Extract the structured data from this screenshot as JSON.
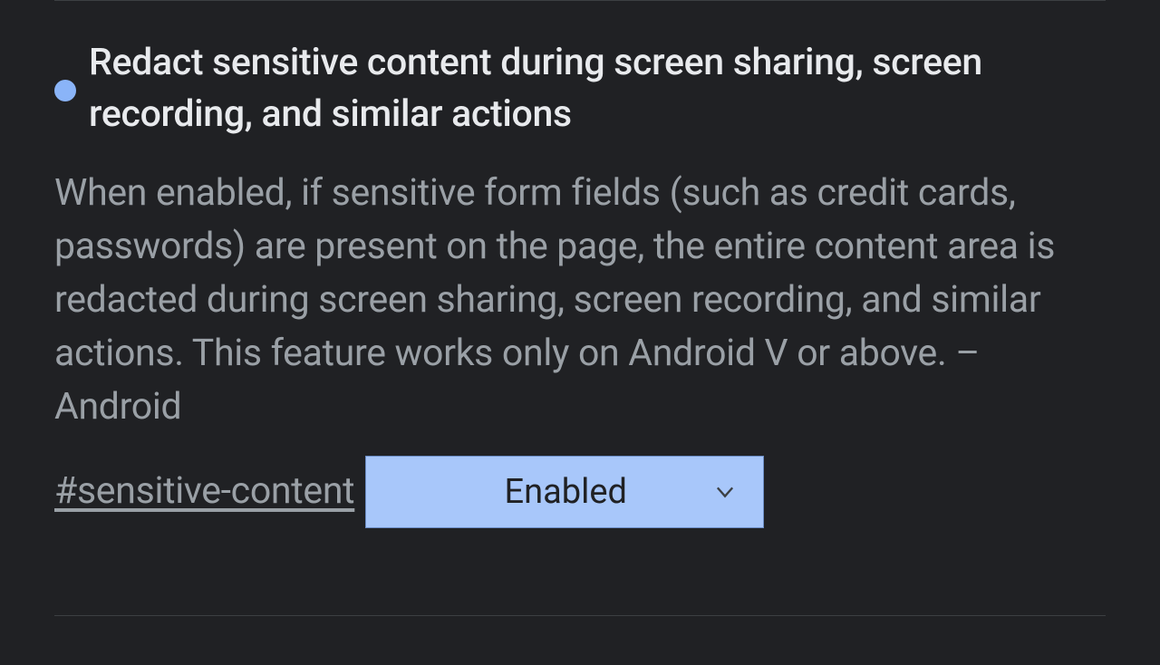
{
  "flag": {
    "title": "Redact sensitive content during screen sharing, screen recording, and similar actions",
    "description": "When enabled, if sensitive form fields (such as credit cards, passwords) are present on the page, the entire content area is redacted during screen sharing, screen recording, and similar actions. This feature works only on Android V or above. – Android",
    "hash": "#sensitive-content",
    "dropdown": {
      "selected": "Enabled"
    }
  },
  "colors": {
    "background": "#202124",
    "primary_text": "#e8eaed",
    "secondary_text": "#9aa0a6",
    "accent": "#8ab4f8",
    "dropdown_bg": "#a8c7fa"
  }
}
